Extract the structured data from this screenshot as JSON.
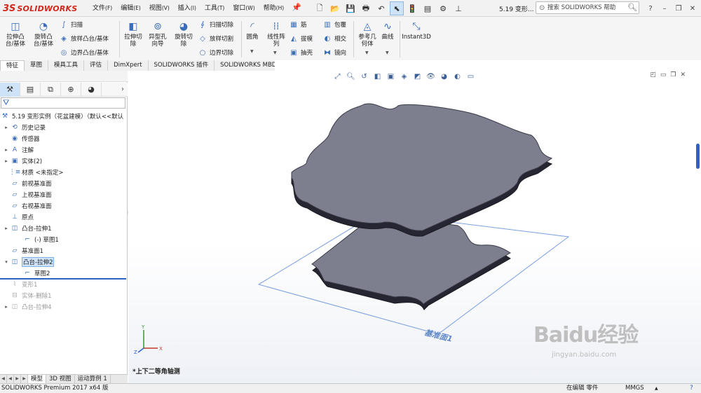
{
  "app": {
    "brand_ds": "3S",
    "brand_name": "SOLIDWORKS",
    "document_title": "5.19 变形...",
    "help_search_placeholder": "搜索 SOLIDWORKS 帮助"
  },
  "menu": [
    {
      "label": "文件",
      "key": "(F)"
    },
    {
      "label": "编辑",
      "key": "(E)"
    },
    {
      "label": "视图",
      "key": "(V)"
    },
    {
      "label": "插入",
      "key": "(I)"
    },
    {
      "label": "工具",
      "key": "(T)"
    },
    {
      "label": "窗口",
      "key": "(W)"
    },
    {
      "label": "帮助",
      "key": "(H)"
    }
  ],
  "quick_access_icons": [
    "new-document-icon",
    "open-icon",
    "save-icon",
    "print-icon",
    "undo-icon",
    "select-icon",
    "rebuild-icon",
    "file-properties-icon",
    "options-icon"
  ],
  "window_controls": [
    "?",
    "–",
    "❐",
    "✕"
  ],
  "commands": {
    "extrude_boss": "拉伸凸\n台/基体",
    "revolve_boss": "旋转凸\n台/基体",
    "sweep": "扫描",
    "loft_boss": "放样凸台/基体",
    "boundary_boss": "边界凸台/基体",
    "extrude_cut": "拉伸切\n除",
    "hole_wizard": "异型孔\n向导",
    "revolve_cut": "旋转切\n除",
    "sweep_cut": "扫描切除",
    "loft_cut": "放样切割",
    "boundary_cut": "边界切除",
    "fillet": "圆角",
    "linear_pattern": "线性阵\n列",
    "rib": "筋",
    "draft": "拔模",
    "shell": "抽壳",
    "wrap": "包覆",
    "intersect": "相交",
    "mirror": "镜向",
    "reference_geometry": "参考几\n何体",
    "curves": "曲线",
    "instant3d": "Instant3D"
  },
  "tabs": [
    {
      "label": "特征",
      "active": true
    },
    {
      "label": "草图",
      "active": false
    },
    {
      "label": "模具工具",
      "active": false
    },
    {
      "label": "评估",
      "active": false
    },
    {
      "label": "DimXpert",
      "active": false
    },
    {
      "label": "SOLIDWORKS 插件",
      "active": false
    },
    {
      "label": "SOLIDWORKS MBD",
      "active": false
    }
  ],
  "feature_tree": {
    "root": "5.19 变形实例（花盆建模）（默认<<默认",
    "items": [
      {
        "label": "历史记录",
        "icon": "history-icon",
        "expandable": true,
        "state": "normal"
      },
      {
        "label": "传感器",
        "icon": "sensor-icon",
        "expandable": false,
        "state": "normal"
      },
      {
        "label": "注解",
        "icon": "annotation-icon",
        "expandable": true,
        "state": "normal"
      },
      {
        "label": "实体(2)",
        "icon": "solid-bodies-icon",
        "expandable": true,
        "state": "normal"
      },
      {
        "label": "材质 <未指定>",
        "icon": "material-icon",
        "expandable": false,
        "state": "normal"
      },
      {
        "label": "前视基准面",
        "icon": "plane-icon",
        "expandable": false,
        "state": "normal"
      },
      {
        "label": "上视基准面",
        "icon": "plane-icon",
        "expandable": false,
        "state": "normal"
      },
      {
        "label": "右视基准面",
        "icon": "plane-icon",
        "expandable": false,
        "state": "normal"
      },
      {
        "label": "原点",
        "icon": "origin-icon",
        "expandable": false,
        "state": "normal"
      },
      {
        "label": "凸台-拉伸1",
        "icon": "extrude-feature-icon",
        "expandable": true,
        "state": "normal"
      },
      {
        "label": "(-) 草图1",
        "icon": "sketch-icon",
        "expandable": false,
        "state": "normal",
        "indent": true
      },
      {
        "label": "基准面1",
        "icon": "plane-icon",
        "expandable": false,
        "state": "normal"
      },
      {
        "label": "凸台-拉伸2",
        "icon": "extrude-feature-icon",
        "expandable": true,
        "state": "selected"
      },
      {
        "label": "草图2",
        "icon": "sketch-icon",
        "expandable": false,
        "state": "normal",
        "indent": true
      },
      {
        "label": "变形1",
        "icon": "flex-feature-icon",
        "expandable": false,
        "state": "suppressed"
      },
      {
        "label": "实体-删除1",
        "icon": "delete-body-icon",
        "expandable": false,
        "state": "suppressed"
      },
      {
        "label": "凸台-拉伸4",
        "icon": "extrude-feature-icon",
        "expandable": true,
        "state": "suppressed"
      }
    ]
  },
  "bottom_tabs": [
    "模型",
    "3D 视图",
    "运动算例 1"
  ],
  "viewport": {
    "plane_label": "基准面1",
    "view_name": "*上下二等角轴测"
  },
  "watermark": {
    "brand": "Baidu经验",
    "url": "jingyan.baidu.com"
  },
  "status": {
    "product": "SOLIDWORKS Premium 2017 x64 版",
    "edit_mode": "在编辑 零件",
    "units": "MMGS"
  }
}
